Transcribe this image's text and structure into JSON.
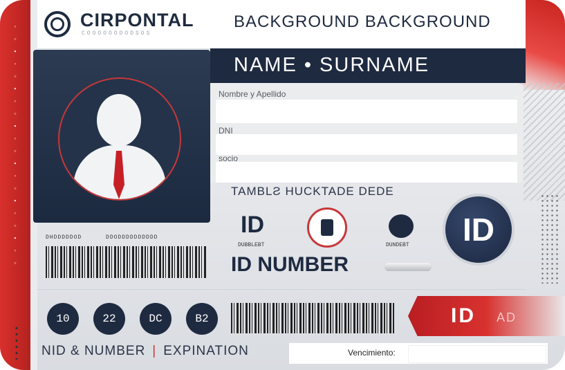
{
  "header": {
    "brand": "CIRPONTAL",
    "brand_sub": "COOOOOODODSOS",
    "background_title": "BACKGROUND BACKGROUND"
  },
  "name_bar": {
    "text": "NAME • SURNAME"
  },
  "form": {
    "fields": [
      {
        "label": "Nombre y Apellido",
        "value": ""
      },
      {
        "label": "DNI",
        "value": ""
      },
      {
        "label": "socio",
        "value": ""
      }
    ]
  },
  "tagline": "TAMBLƧ HUCKTADE DEDE",
  "barcode_labels": {
    "left": "DHDDDDDOD",
    "right": "DDODDDDDDDDDD"
  },
  "icons": {
    "id_small": "ID",
    "id_small_sub": "DUBBLEBT",
    "lock_sub": "DUNDEBT",
    "big_id": "ID",
    "icon_names": [
      "user-avatar-icon",
      "document-icon",
      "lock-icon",
      "id-badge-icon"
    ]
  },
  "id_number": "ID NUMBER",
  "circles": [
    "10",
    "22",
    "DC",
    "B2"
  ],
  "ribbon": {
    "main": "ID",
    "sub": "AD"
  },
  "bottom": {
    "left_label": "NID & NUMBER",
    "separator": "|",
    "right_label": "EXPINATION"
  },
  "expiry": {
    "label": "Vencimiento:",
    "value": ""
  },
  "colors": {
    "navy": "#1e2a40",
    "red": "#c6383a"
  }
}
